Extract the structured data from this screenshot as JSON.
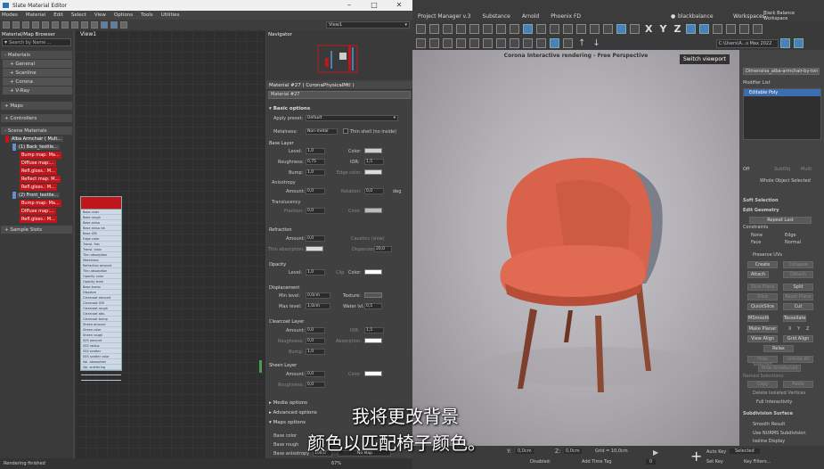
{
  "sme": {
    "title": "Slate Material Editor",
    "menu": [
      "Modes",
      "Material",
      "Edit",
      "Select",
      "View",
      "Options",
      "Tools",
      "Utilities"
    ],
    "browser_title": "Material/Map Browser",
    "search_placeholder": "Search by Name ...",
    "materials_header": "- Materials",
    "materials": [
      "+ General",
      "+ Scanline",
      "+ Corona",
      "+ V-Ray"
    ],
    "maps": "+ Maps",
    "controllers": "+ Controllers",
    "scene_materials": "- Scene Materials",
    "tree": {
      "root": "Alba Armchair ( Mult...",
      "back": "(1) Back_textile...",
      "back_children": [
        "Bump map: Ma...",
        "Diffuse map:...",
        "Refl.gloss.: M...",
        "Reflect map: M...",
        "Refl.gloss.: M..."
      ],
      "front": "(2) Front_textile...",
      "front_children": [
        "Bump map: Ma...",
        "Diffuse map:...",
        "Refl.gloss.: M..."
      ]
    },
    "sample_slots": "+ Sample Slots",
    "view_label": "View1",
    "view_dropdown": "View1",
    "navigator": "Navigator",
    "mat_title": "Material #27 ( CoronaPhysicalMtl )",
    "mat_name": "Material #27",
    "node_items": [
      "Base color",
      "Base rough",
      "Base aniso",
      "Base aniso rot",
      "Base IOR",
      "Edge color",
      "Transl. frac",
      "Transl. color",
      "Thin absorption",
      "Metalness",
      "Refraction amount",
      "Thin absorption",
      "Opacity color",
      "Opacity level",
      "Base bump",
      "Displace",
      "Clearcoat amount",
      "Clearcoat IOR",
      "Clearcoat rough",
      "Clearcoat abs.",
      "Clearcoat bump",
      "Sheen amount",
      "Sheen color",
      "Sheen rough",
      "SSS amount",
      "SSS radius",
      "SSS scatter",
      "SSS scatter color",
      "Vol. absorption",
      "Vol. scattering",
      "Refl. rou",
      "Refl. tra"
    ],
    "basic_options": "Basic options",
    "apply_preset_label": "Apply preset:",
    "apply_preset_value": "Default",
    "metalness_label": "Metalness:",
    "metalness_value": "Non-metal",
    "thin_shell": "Thin shell (no inside)",
    "base_layer": "Base Layer",
    "level_label": "Level:",
    "level_value": "1,0",
    "color_label": "Color:",
    "roughness_label": "Roughness:",
    "roughness_value": "0,75",
    "ior_label": "IOR:",
    "ior_value": "1,5",
    "bump_label": "Bump:",
    "bump_value": "1,0",
    "edge_color_label": "Edge color:",
    "anisotropy": "Anisotropy",
    "amount_label": "Amount:",
    "amount_value": "0,0",
    "rotation_label": "Rotation:",
    "rotation_value": "0,0",
    "deg": "deg",
    "translucency": "Translucency",
    "fraction_label": "Fraction:",
    "fraction_value": "0,0",
    "refraction": "Refraction",
    "caustics": "Caustics (slow)",
    "thin_absorption": "Thin absorption:",
    "dispersion": "Dispersion:",
    "dispersion_value": "20,0",
    "opacity": "Opacity",
    "clip": "Clip",
    "displacement": "Displacement",
    "min_level": "Min level:",
    "min_value": "0,0cm",
    "max_level": "Max level:",
    "max_value": "1,0cm",
    "texture_label": "Texture:",
    "water_level": "Water lvl.:",
    "water_value": "0,5",
    "clearcoat_layer": "Clearcoat Layer",
    "absorption_label": "Absorption:",
    "sheen_layer": "Sheen Layer",
    "media_options": "Media options",
    "advanced_options": "Advanced options",
    "maps_options": "Maps options",
    "map_list": [
      "Base color",
      "Base rough",
      "Base anisotropy"
    ],
    "map_amount": "100,0",
    "no_map": "No Map",
    "status": "Rendering finished",
    "zoom": "67%"
  },
  "max": {
    "menu": [
      "Project Manager v.3",
      "Substance",
      "Arnold",
      "Phoenix FD"
    ],
    "workspace_label": "Workspaces:",
    "workspace_value": "Black Balance Workspace",
    "blackbalance": "blackbalance",
    "path": "C:\\Users\\A...s Max 2022",
    "viewport_title": "Corona Interactive rendering - Free Perspective",
    "switch_viewport": "Switch viewport",
    "object_name": "Dimensiva_alba-armchair-by-ton",
    "modifier_list": "Modifier List",
    "editable_poly": "Editable Poly",
    "selection_off": "Off",
    "subobj": "SubObj",
    "multi": "Multi",
    "whole_object": "Whole Object Selected",
    "soft_selection": "Soft Selection",
    "edit_geometry": "Edit Geometry",
    "repeat_last": "Repeat Last",
    "constraints": "Constraints",
    "none": "None",
    "edge": "Edge",
    "face": "Face",
    "normal": "Normal",
    "preserve_uvs": "Preserve UVs",
    "create": "Create",
    "collapse": "Collapse",
    "attach": "Attach",
    "detach": "Detach",
    "slice_plane": "Slice Plane",
    "split": "Split",
    "slice": "Slice",
    "reset_plane": "Reset Plane",
    "quickslice": "QuickSlice",
    "cut": "Cut",
    "msmooth": "MSmooth",
    "tessellate": "Tessellate",
    "make_planar": "Make Planar",
    "x": "X",
    "y": "Y",
    "z": "Z",
    "view_align": "View Align",
    "grid_align": "Grid Align",
    "relax": "Relax",
    "hide_selected": "Hide Selected",
    "unhide_all": "Unhide All",
    "hide_unselected": "Hide Unselected",
    "named_selections": "Named Selections:",
    "copy": "Copy",
    "paste": "Paste",
    "delete_isolated": "Delete Isolated Vertices",
    "full_interactivity": "Full Interactivity",
    "subdivision_surface": "Subdivision Surface",
    "smooth_result": "Smooth Result",
    "use_nurms": "Use NURMS Subdivision",
    "isoline_display": "Isoline Display",
    "coord_y": "0,0cm",
    "coord_z": "0,0cm",
    "grid": "Grid = 10,0cm",
    "auto_key": "Auto Key",
    "set_key": "Set Key",
    "selected": "Selected",
    "key_filters": "Key Filters...",
    "disabled": "Disabled:",
    "add_time_tag": "Add Time Tag",
    "frame": "0"
  },
  "subtitles": {
    "line1": "我将更改背景",
    "line2": "颜色以匹配椅子颜色。"
  },
  "colors": {
    "red_tag": "#c0151a",
    "accent_blue": "#4a7fb8",
    "chair_fabric": "#d9634a",
    "chair_back": "#7a7e88",
    "chair_legs": "#8c4a32"
  }
}
